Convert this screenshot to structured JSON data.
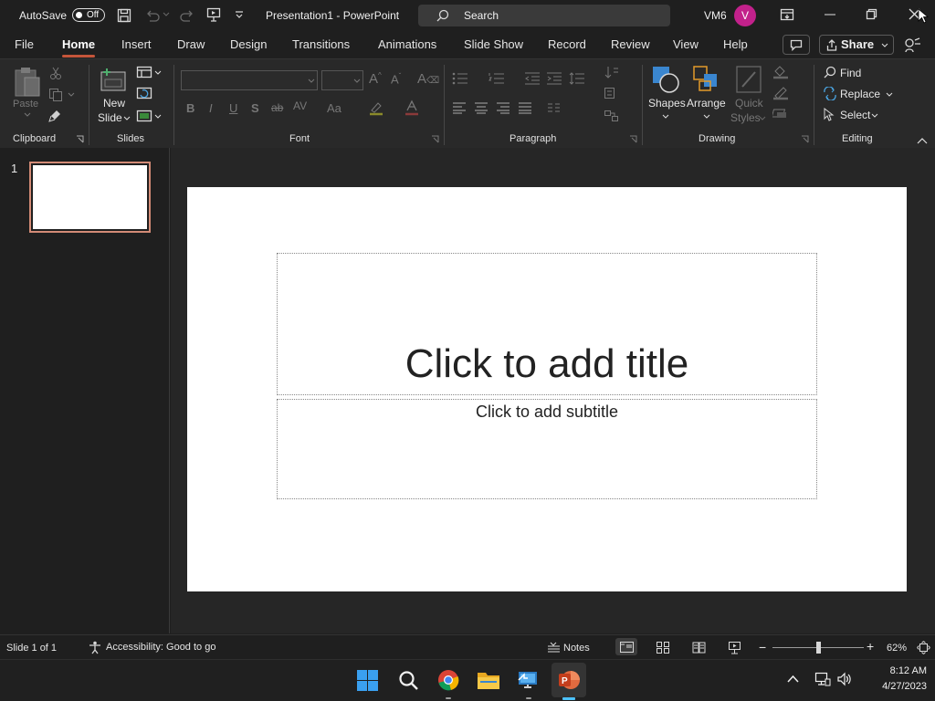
{
  "titlebar": {
    "autosave_label": "AutoSave",
    "autosave_state": "Off",
    "doc_title": "Presentation1  -  PowerPoint",
    "search_placeholder": "Search",
    "user_initials": "VM6",
    "avatar_letter": "V",
    "avatar_color": "#c2218b"
  },
  "tabs": [
    "File",
    "Home",
    "Insert",
    "Draw",
    "Design",
    "Transitions",
    "Animations",
    "Slide Show",
    "Record",
    "Review",
    "View",
    "Help"
  ],
  "active_tab": "Home",
  "share_label": "Share",
  "ribbon": {
    "clipboard": {
      "label": "Clipboard",
      "paste": "Paste"
    },
    "slides": {
      "label": "Slides",
      "new_slide_line1": "New",
      "new_slide_line2": "Slide"
    },
    "font": {
      "label": "Font"
    },
    "paragraph": {
      "label": "Paragraph"
    },
    "drawing": {
      "label": "Drawing",
      "shapes": "Shapes",
      "arrange": "Arrange",
      "quick_styles_line1": "Quick",
      "quick_styles_line2": "Styles"
    },
    "editing": {
      "label": "Editing",
      "find": "Find",
      "replace": "Replace",
      "select": "Select"
    }
  },
  "thumbnails": [
    {
      "number": "1"
    }
  ],
  "slide": {
    "title_placeholder": "Click to add title",
    "subtitle_placeholder": "Click to add subtitle"
  },
  "statusbar": {
    "slide_counter": "Slide 1 of 1",
    "accessibility": "Accessibility: Good to go",
    "notes": "Notes",
    "zoom_percent": "62%",
    "zoom_fraction": 0.5
  },
  "taskbar": {
    "time": "8:12 AM",
    "date": "4/27/2023"
  },
  "colors": {
    "accent": "#c5553a",
    "app_red": "#c43e1c"
  }
}
